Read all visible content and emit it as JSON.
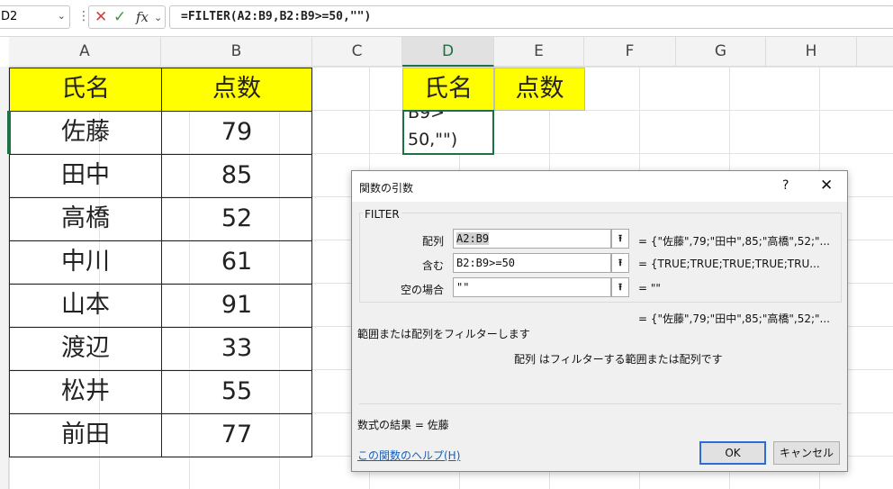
{
  "formula_bar": {
    "name_box": "D2",
    "cancel_icon": "✕",
    "enter_icon": "✓",
    "fx_label": "fx",
    "formula": "=FILTER(A2:B9,B2:B9>=50,\"\")"
  },
  "columns": [
    "A",
    "B",
    "C",
    "D",
    "E",
    "F",
    "G",
    "H"
  ],
  "table": {
    "headers": [
      "氏名",
      "点数"
    ],
    "rows": [
      [
        "佐藤",
        "79"
      ],
      [
        "田中",
        "85"
      ],
      [
        "高橋",
        "52"
      ],
      [
        "中川",
        "61"
      ],
      [
        "山本",
        "91"
      ],
      [
        "渡辺",
        "33"
      ],
      [
        "松井",
        "55"
      ],
      [
        "前田",
        "77"
      ]
    ]
  },
  "result_headers": [
    "氏名",
    "点数"
  ],
  "edit_cell": {
    "line1": "B9>",
    "line2": "50,\"\")"
  },
  "dialog": {
    "title": "関数の引数",
    "help_symbol": "?",
    "close_symbol": "✕",
    "function_name": "FILTER",
    "args": [
      {
        "label": "配列",
        "value": "A2:B9",
        "result": "=   {\"佐藤\",79;\"田中\",85;\"高橋\",52;\"..."
      },
      {
        "label": "含む",
        "value": "B2:B9>=50",
        "result": "=   {TRUE;TRUE;TRUE;TRUE;TRU..."
      },
      {
        "label": "空の場合",
        "value": "\"\"",
        "result": "=   \"\""
      }
    ],
    "overall_result": "=   {\"佐藤\",79;\"田中\",85;\"高橋\",52;\"...",
    "description": "範囲または配列をフィルターします",
    "arg_description": "配列   はフィルターする範囲または配列です",
    "formula_result": "数式の結果 =   佐藤",
    "help_link": "この関数のヘルプ(H)",
    "ok_label": "OK",
    "cancel_label": "キャンセル"
  },
  "colors": {
    "selection_green": "#1e7145",
    "header_yellow": "#ffff00",
    "link_blue": "#1a5fb4"
  }
}
